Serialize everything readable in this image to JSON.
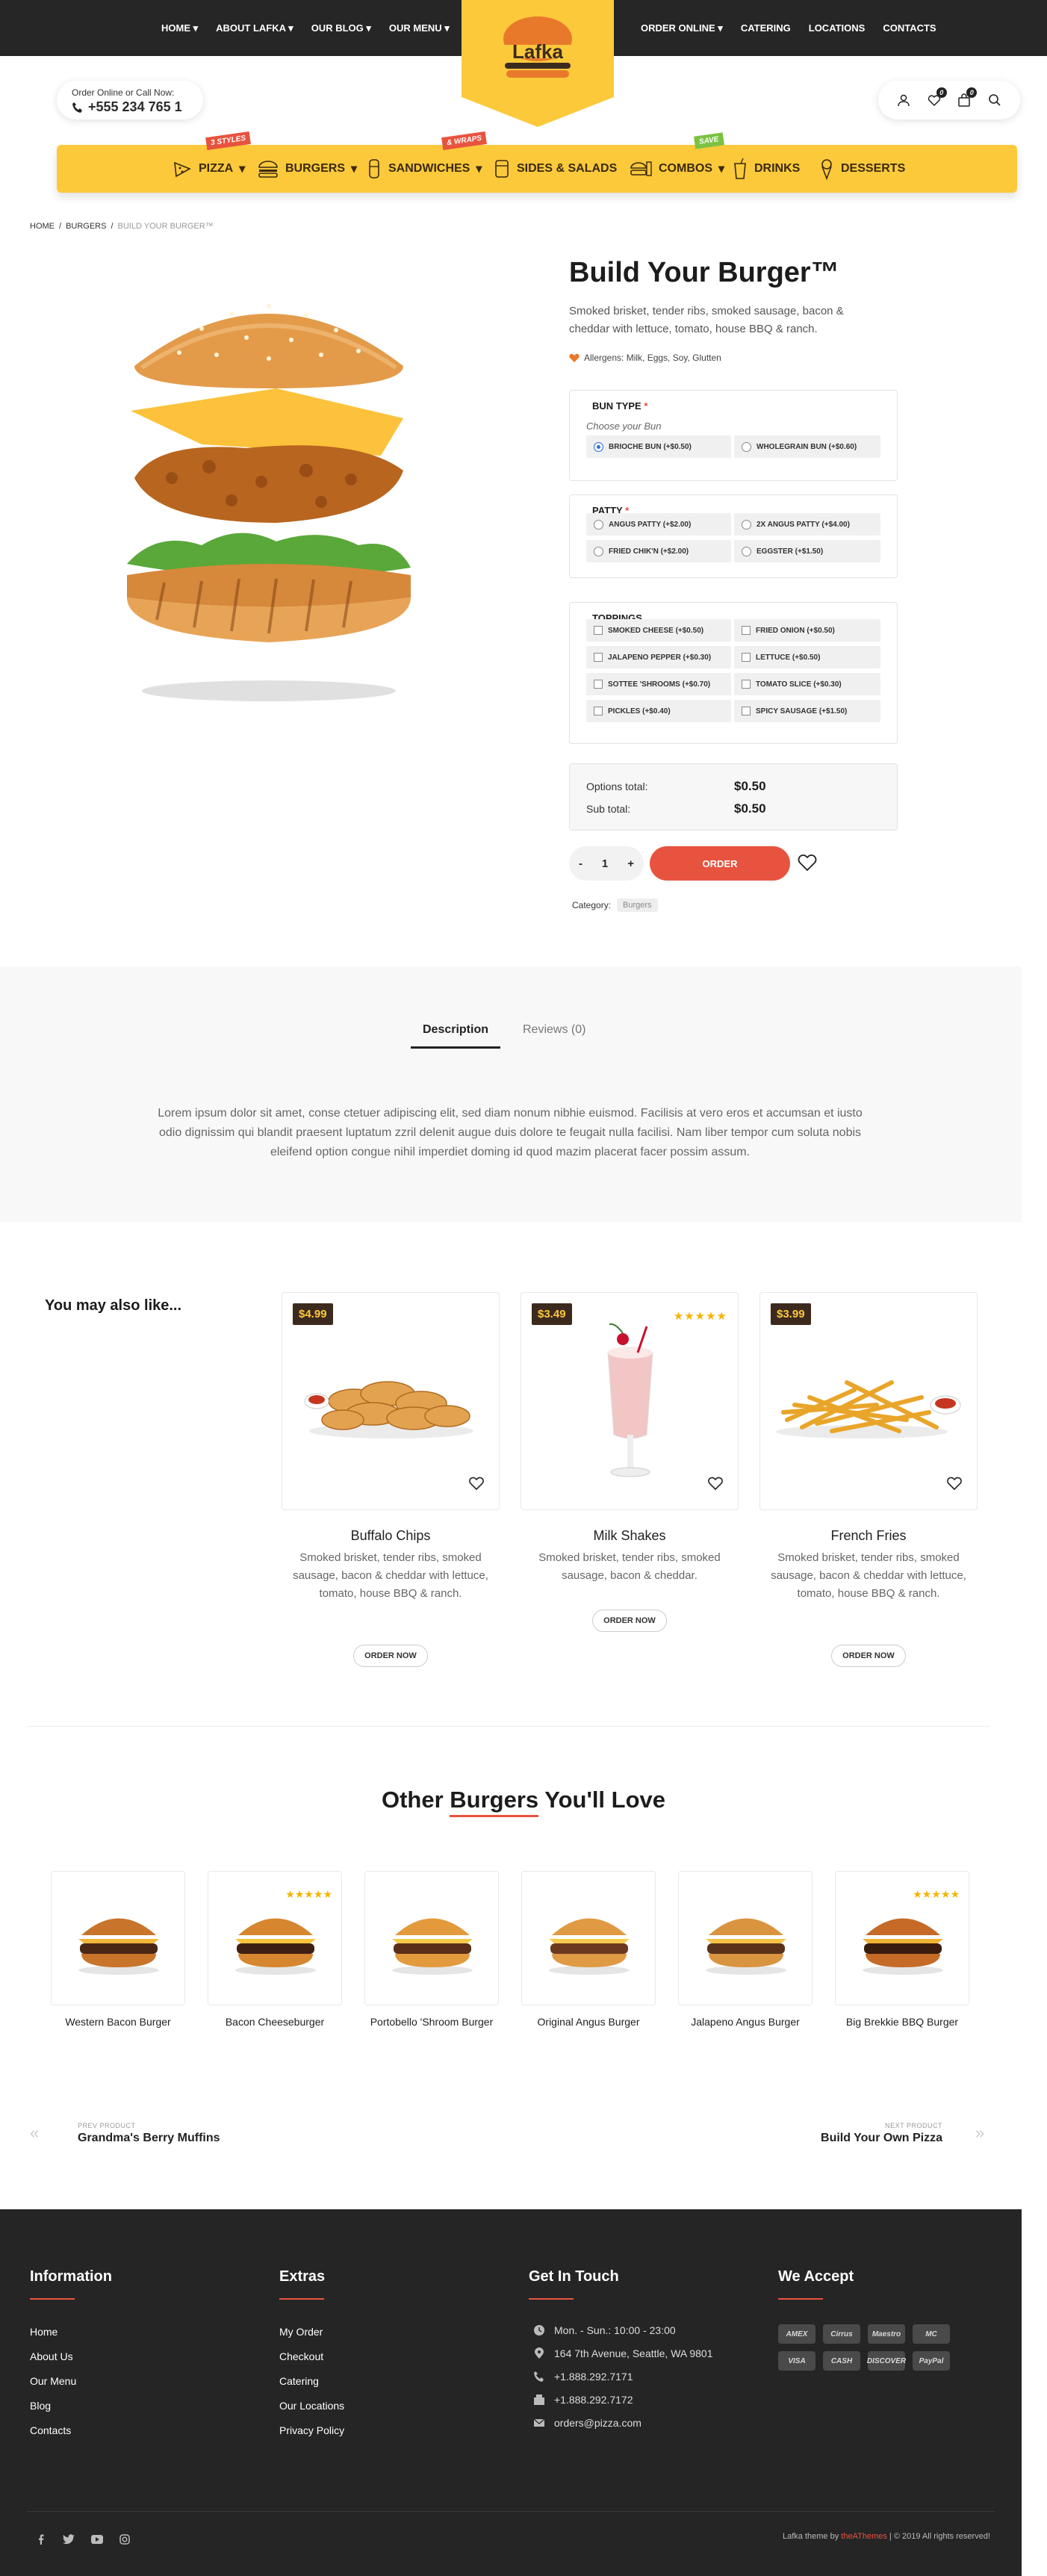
{
  "topnav": {
    "left": [
      "HOME",
      "ABOUT LAFKA",
      "OUR BLOG",
      "OUR MENU"
    ],
    "right": [
      "ORDER ONLINE",
      "CATERING",
      "LOCATIONS",
      "CONTACTS"
    ]
  },
  "logo": {
    "text": "Lafka"
  },
  "header": {
    "call_label": "Order Online or Call Now:",
    "phone": "+555 234 765 1",
    "wishlist_count": "0",
    "cart_count": "0"
  },
  "categories": [
    {
      "label": "PIZZA",
      "ribbon": "3 STYLES",
      "ribbon_color": "#e8533f"
    },
    {
      "label": "BURGERS"
    },
    {
      "label": "SANDWICHES",
      "ribbon": "& WRAPS",
      "ribbon_color": "#e8533f"
    },
    {
      "label": "SIDES & SALADS"
    },
    {
      "label": "COMBOS",
      "ribbon": "SAVE",
      "ribbon_color": "#7cc242"
    },
    {
      "label": "DRINKS"
    },
    {
      "label": "DESSERTS"
    }
  ],
  "breadcrumb": {
    "home": "HOME",
    "sep1": "/",
    "burgers": "BURGERS",
    "sep2": "/",
    "current": "BUILD YOUR BURGER™"
  },
  "product": {
    "title": "Build Your Burger™",
    "description": "Smoked brisket, tender ribs, smoked sausage, bacon & cheddar with lettuce, tomato, house BBQ & ranch.",
    "allergens": "Allergens: Milk, Eggs, Soy, Glutten",
    "bun_title": "BUN TYPE",
    "required_mark": "*",
    "bun_placeholder": "Choose your Bun",
    "buns": [
      "BRIOCHE BUN (+$0.50)",
      "WHOLEGRAIN BUN (+$0.60)"
    ],
    "patty_title": "PATTY",
    "patties": [
      "ANGUS PATTY (+$2.00)",
      "2X ANGUS PATTY (+$4.00)",
      "FRIED CHIK'N (+$2.00)",
      "EGGSTER (+$1.50)"
    ],
    "toppings_title": "TOPPINGS",
    "toppings": [
      "SMOKED CHEESE (+$0.50)",
      "FRIED ONION (+$0.50)",
      "JALAPENO PEPPER (+$0.30)",
      "LETTUCE (+$0.50)",
      "SOTTEE 'SHROOMS (+$0.70)",
      "TOMATO SLICE (+$0.30)",
      "PICKLES (+$0.40)",
      "SPICY SAUSAGE (+$1.50)"
    ],
    "options_total_label": "Options total:",
    "options_total": "$0.50",
    "subtotal_label": "Sub total:",
    "subtotal": "$0.50",
    "qty_minus": "-",
    "qty": "1",
    "qty_plus": "+",
    "order_label": "ORDER",
    "category_label": "Category:",
    "category_value": "Burgers"
  },
  "tabs": {
    "description": "Description",
    "reviews": "Reviews (0)"
  },
  "lorem": "Lorem ipsum dolor sit amet, conse ctetuer adipiscing elit, sed diam nonum nibhie euismod. Facilisis at vero eros et accumsan et iusto odio dignissim qui blandit praesent luptatum zzril delenit augue duis dolore te feugait nulla facilisi. Nam liber tempor cum soluta nobis eleifend option congue nihil imperdiet doming id quod mazim placerat facer possim assum.",
  "related": {
    "title": "You may also like...",
    "items": [
      {
        "price": "$4.99",
        "name": "Buffalo Chips",
        "desc": "Smoked brisket, tender ribs, smoked sausage, bacon & cheddar with lettuce, tomato, house BBQ & ranch.",
        "button": "ORDER NOW",
        "stars": ""
      },
      {
        "price": "$3.49",
        "name": "Milk Shakes",
        "desc": "Smoked brisket, tender ribs, smoked sausage, bacon & cheddar.",
        "button": "ORDER NOW",
        "stars": "★★★★★"
      },
      {
        "price": "$3.99",
        "name": "French Fries",
        "desc": "Smoked brisket, tender ribs, smoked sausage, bacon & cheddar with lettuce, tomato, house BBQ & ranch.",
        "button": "ORDER NOW",
        "stars": ""
      }
    ]
  },
  "other": {
    "title_a": "Other ",
    "title_hl": "Burgers",
    "title_b": " You'll Love",
    "items": [
      {
        "name": "Western Bacon Burger",
        "stars": ""
      },
      {
        "name": "Bacon Cheeseburger",
        "stars": "★★★★★"
      },
      {
        "name": "Portobello 'Shroom Burger",
        "stars": ""
      },
      {
        "name": "Original Angus Burger",
        "stars": ""
      },
      {
        "name": "Jalapeno Angus Burger",
        "stars": ""
      },
      {
        "name": "Big Brekkie BBQ Burger",
        "stars": "★★★★★"
      }
    ]
  },
  "prevnext": {
    "prev_label": "PREV PRODUCT",
    "prev_name": "Grandma's Berry Muffins",
    "next_label": "NEXT PRODUCT",
    "next_name": "Build Your Own Pizza"
  },
  "footer": {
    "info_title": "Information",
    "info_links": [
      "Home",
      "About Us",
      "Our Menu",
      "Blog",
      "Contacts"
    ],
    "extras_title": "Extras",
    "extras_links": [
      "My Order",
      "Checkout",
      "Catering",
      "Our Locations",
      "Privacy Policy"
    ],
    "touch_title": "Get In Touch",
    "hours": "Mon. - Sun.: 10:00 - 23:00",
    "address": "164 7th Avenue, Seattle, WA 9801",
    "phone1": "+1.888.292.7171",
    "phone2": "+1.888.292.7172",
    "email": "orders@pizza.com",
    "accept_title": "We Accept",
    "cards": [
      "AMEX",
      "Cirrus",
      "Maestro",
      "MC",
      "VISA",
      "CASH",
      "DISCOVER",
      "PayPal"
    ],
    "credit_a": "Lafka theme by ",
    "credit_brand": "theAThemes",
    "credit_b": " | © 2019 All rights reserved!"
  }
}
